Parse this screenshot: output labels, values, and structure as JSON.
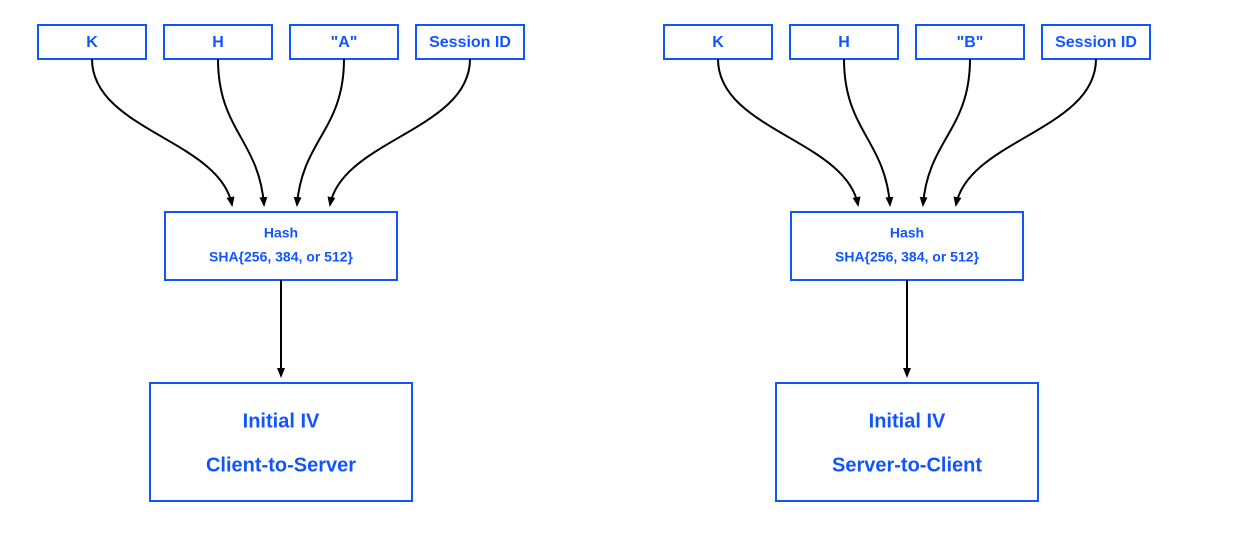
{
  "left": {
    "inputs": [
      "K",
      "H",
      "\"A\"",
      "Session ID"
    ],
    "hash_title": "Hash",
    "hash_detail": "SHA{256, 384, or 512}",
    "out_title": "Initial IV",
    "out_detail": "Client-to-Server"
  },
  "right": {
    "inputs": [
      "K",
      "H",
      "\"B\"",
      "Session ID"
    ],
    "hash_title": "Hash",
    "hash_detail": "SHA{256, 384, or 512}",
    "out_title": "Initial IV",
    "out_detail": "Server-to-Client"
  }
}
